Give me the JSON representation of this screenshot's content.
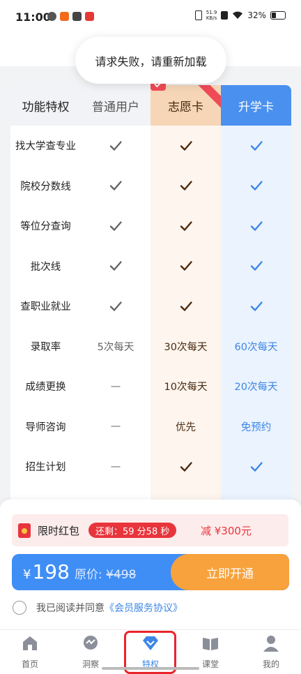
{
  "status_bar": {
    "time": "11:00",
    "net_speed_value": "51.9",
    "net_speed_unit": "KB/s",
    "battery": "32%"
  },
  "toast": {
    "message": "请求失败，请重新加载"
  },
  "table": {
    "headers": {
      "feature": "功能特权",
      "normal": "普通用户",
      "zhiyuan": "志愿卡",
      "shengxue": "升学卡"
    },
    "rows": [
      {
        "feature": "找大学查专业",
        "normal": "check",
        "zhiyuan": "check",
        "shengxue": "check"
      },
      {
        "feature": "院校分数线",
        "normal": "check",
        "zhiyuan": "check",
        "shengxue": "check"
      },
      {
        "feature": "等位分查询",
        "normal": "check",
        "zhiyuan": "check",
        "shengxue": "check"
      },
      {
        "feature": "批次线",
        "normal": "check",
        "zhiyuan": "check",
        "shengxue": "check"
      },
      {
        "feature": "查职业就业",
        "normal": "check",
        "zhiyuan": "check",
        "shengxue": "check"
      },
      {
        "feature": "录取率",
        "normal": "5次每天",
        "zhiyuan": "30次每天",
        "shengxue": "60次每天"
      },
      {
        "feature": "成绩更换",
        "normal": "—",
        "zhiyuan": "10次每天",
        "shengxue": "20次每天"
      },
      {
        "feature": "导师咨询",
        "normal": "—",
        "zhiyuan": "优先",
        "shengxue": "免预约"
      },
      {
        "feature": "招生计划",
        "normal": "—",
        "zhiyuan": "check",
        "shengxue": "check"
      }
    ]
  },
  "red_packet": {
    "label": "限时红包",
    "timer": "还剩：59 分58 秒",
    "discount": "减 ¥300元"
  },
  "purchase": {
    "currency": "¥",
    "price": "198",
    "original_label": "原价:",
    "original_price": "¥498",
    "button": "立即开通"
  },
  "agreement": {
    "text": "我已阅读并同意",
    "link": "《会员服务协议》"
  },
  "tabs": [
    {
      "label": "首页",
      "icon": "home-icon"
    },
    {
      "label": "洞察",
      "icon": "insight-icon"
    },
    {
      "label": "特权",
      "icon": "diamond-icon",
      "active": true
    },
    {
      "label": "课堂",
      "icon": "book-icon"
    },
    {
      "label": "我的",
      "icon": "user-icon"
    }
  ],
  "colors": {
    "accent_blue": "#3d86e6",
    "orange": "#f7a23c",
    "red": "#e8353c",
    "zhiyuan_text": "#4a2a10"
  }
}
